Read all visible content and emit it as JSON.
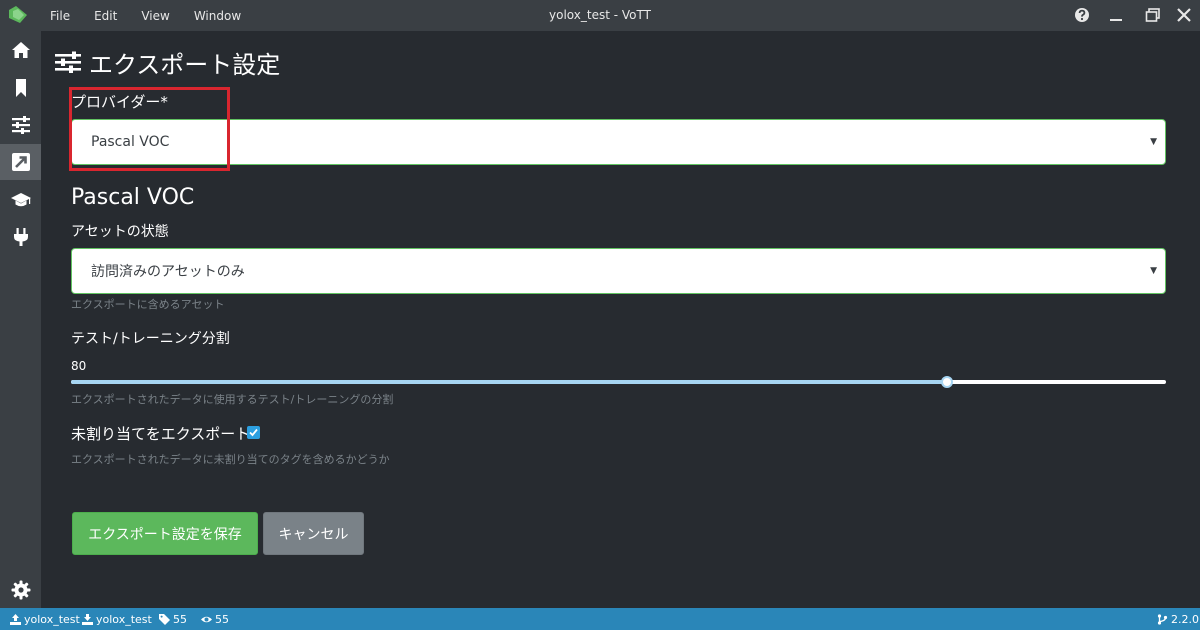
{
  "window": {
    "menu": [
      "File",
      "Edit",
      "View",
      "Window"
    ],
    "title": "yolox_test - VoTT"
  },
  "sidebar": {
    "items": [
      {
        "icon": "home-icon"
      },
      {
        "icon": "bookmark-icon"
      },
      {
        "icon": "sliders-icon"
      },
      {
        "icon": "export-icon",
        "active": true
      },
      {
        "icon": "graduation-cap-icon"
      },
      {
        "icon": "plug-icon"
      }
    ],
    "settings_icon": "gear-icon"
  },
  "page": {
    "title": "エクスポート設定",
    "provider_label": "プロバイダー*",
    "provider_value": "Pascal VOC",
    "section_title": "Pascal VOC",
    "asset_state_label": "アセットの状態",
    "asset_state_value": "訪問済みのアセットのみ",
    "asset_state_hint": "エクスポートに含めるアセット",
    "split_label": "テスト/トレーニング分割",
    "split_value": "80",
    "split_fraction": 0.8,
    "split_hint": "エクスポートされたデータに使用するテスト/トレーニングの分割",
    "unassigned_label": "未割り当てをエクスポート",
    "unassigned_checked": true,
    "unassigned_hint": "エクスポートされたデータに未割り当てのタグを含めるかどうか",
    "save_button": "エクスポート設定を保存",
    "cancel_button": "キャンセル"
  },
  "statusbar": {
    "source_connection": "yolox_test",
    "target_connection": "yolox_test",
    "tag_count": "55",
    "visited_count": "55",
    "version": "2.2.0"
  },
  "colors": {
    "accent_green": "#5cb85c",
    "status_blue": "#2a86b8",
    "highlight_red": "#d9262f"
  }
}
